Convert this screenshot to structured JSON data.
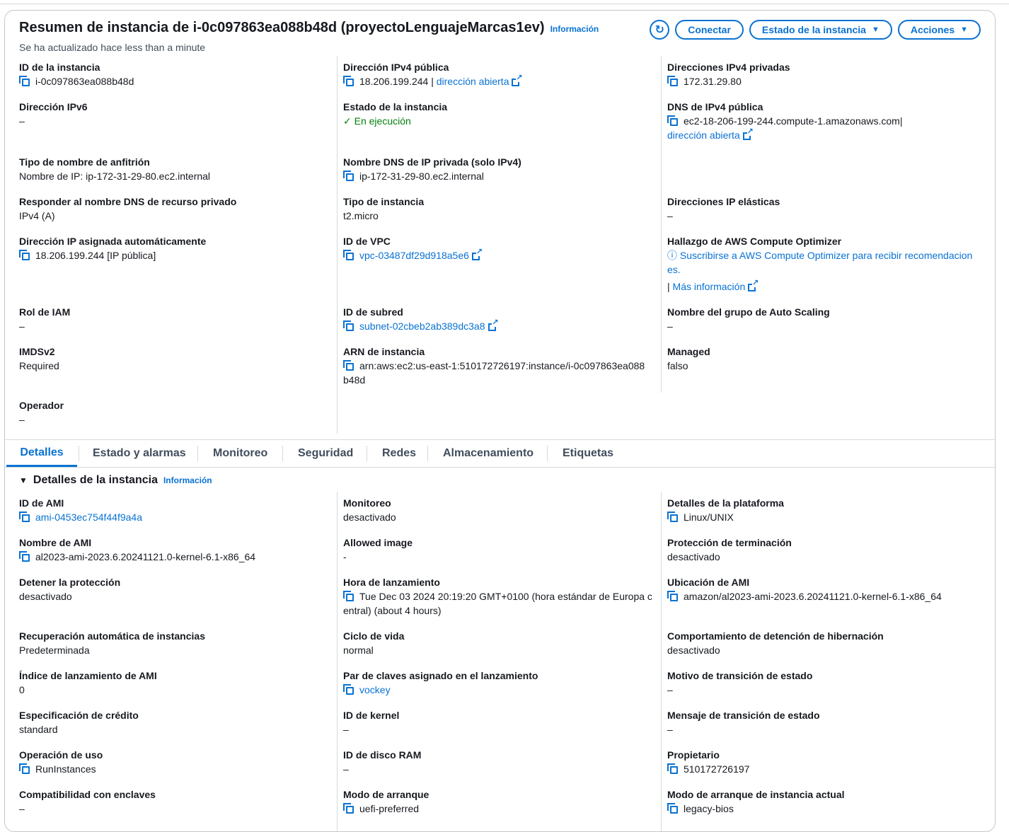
{
  "header": {
    "title": "Resumen de instancia de i-0c097863ea088b48d (proyectoLenguajeMarcas1ev)",
    "info": "Información",
    "subtitle": "Se ha actualizado hace less than a minute",
    "buttons": {
      "connect": "Conectar",
      "state": "Estado de la instancia",
      "actions": "Acciones"
    }
  },
  "summary": {
    "instance_id": {
      "label": "ID de la instancia",
      "value": "i-0c097863ea088b48d"
    },
    "ipv6": {
      "label": "Dirección IPv6",
      "value": "–"
    },
    "hostname_type": {
      "label": "Tipo de nombre de anfitrión",
      "value": "Nombre de IP: ip-172-31-29-80.ec2.internal"
    },
    "dns_respond": {
      "label": "Responder al nombre DNS de recurso privado",
      "value": "IPv4 (A)"
    },
    "auto_ip": {
      "label": "Dirección IP asignada automáticamente",
      "value": "18.206.199.244 [IP pública]"
    },
    "iam_role": {
      "label": "Rol de IAM",
      "value": "–"
    },
    "imdsv2": {
      "label": "IMDSv2",
      "value": "Required"
    },
    "operator": {
      "label": "Operador",
      "value": "–"
    },
    "public_ipv4": {
      "label": "Dirección IPv4 pública",
      "value": "18.206.199.244",
      "sep": "|",
      "link": "dirección abierta"
    },
    "state": {
      "label": "Estado de la instancia",
      "value": "En ejecución"
    },
    "private_dns": {
      "label": "Nombre DNS de IP privada (solo IPv4)",
      "value": "ip-172-31-29-80.ec2.internal"
    },
    "instance_type": {
      "label": "Tipo de instancia",
      "value": "t2.micro"
    },
    "vpc": {
      "label": "ID de VPC",
      "value": "vpc-03487df29d918a5e6"
    },
    "subnet": {
      "label": "ID de subred",
      "value": "subnet-02cbeb2ab389dc3a8"
    },
    "arn": {
      "label": "ARN de instancia",
      "value1": "arn:aws:ec2:us-east-1:510172726197:instance/i-0c097863ea088",
      "value2": "b48d"
    },
    "private_ipv4": {
      "label": "Direcciones IPv4 privadas",
      "value": "172.31.29.80"
    },
    "public_dns": {
      "label": "DNS de IPv4 pública",
      "value": "ec2-18-206-199-244.compute-1.amazonaws.com",
      "sep": "|",
      "link": "dirección abierta"
    },
    "elastic_ip": {
      "label": "Direcciones IP elásticas",
      "value": "–"
    },
    "optimizer": {
      "label": "Hallazgo de AWS Compute Optimizer",
      "link1": "Suscribirse a AWS Compute Optimizer para recibir recomendacion",
      "link2": "es.",
      "sep": "|",
      "more": "Más información"
    },
    "asg": {
      "label": "Nombre del grupo de Auto Scaling",
      "value": "–"
    },
    "managed": {
      "label": "Managed",
      "value": "falso"
    }
  },
  "tabs": [
    "Detalles",
    "Estado y alarmas",
    "Monitoreo",
    "Seguridad",
    "Redes",
    "Almacenamiento",
    "Etiquetas"
  ],
  "details": {
    "title": "Detalles de la instancia",
    "info": "Información",
    "ami_id": {
      "label": "ID de AMI",
      "value": "ami-0453ec754f44f9a4a"
    },
    "ami_name": {
      "label": "Nombre de AMI",
      "value": "al2023-ami-2023.6.20241121.0-kernel-6.1-x86_64"
    },
    "stop_protection": {
      "label": "Detener la protección",
      "value": "desactivado"
    },
    "auto_recovery": {
      "label": "Recuperación automática de instancias",
      "value": "Predeterminada"
    },
    "ami_launch_index": {
      "label": "Índice de lanzamiento de AMI",
      "value": "0"
    },
    "credit_spec": {
      "label": "Especificación de crédito",
      "value": "standard"
    },
    "usage_op": {
      "label": "Operación de uso",
      "value": "RunInstances"
    },
    "enclaves": {
      "label": "Compatibilidad con enclaves",
      "value": "–"
    },
    "monitoring": {
      "label": "Monitoreo",
      "value": "desactivado"
    },
    "allowed_image": {
      "label": "Allowed image",
      "value": "-"
    },
    "launch_time": {
      "label": "Hora de lanzamiento",
      "value1": "Tue Dec 03 2024 20:19:20 GMT+0100 (hora estándar de Europa c",
      "value2": "entral) (about 4 hours)"
    },
    "lifecycle": {
      "label": "Ciclo de vida",
      "value": "normal"
    },
    "key_pair": {
      "label": "Par de claves asignado en el lanzamiento",
      "value": "vockey"
    },
    "kernel_id": {
      "label": "ID de kernel",
      "value": "–"
    },
    "ramdisk_id": {
      "label": "ID de disco RAM",
      "value": "–"
    },
    "boot_mode": {
      "label": "Modo de arranque",
      "value": "uefi-preferred"
    },
    "platform": {
      "label": "Detalles de la plataforma",
      "value": "Linux/UNIX"
    },
    "term_protection": {
      "label": "Protección de terminación",
      "value": "desactivado"
    },
    "ami_location": {
      "label": "Ubicación de AMI",
      "value": "amazon/al2023-ami-2023.6.20241121.0-kernel-6.1-x86_64"
    },
    "hibernation": {
      "label": "Comportamiento de detención de hibernación",
      "value": "desactivado"
    },
    "transition_reason": {
      "label": "Motivo de transición de estado",
      "value": "–"
    },
    "transition_msg": {
      "label": "Mensaje de transición de estado",
      "value": "–"
    },
    "owner": {
      "label": "Propietario",
      "value": "510172726197"
    },
    "current_boot": {
      "label": "Modo de arranque de instancia actual",
      "value": "legacy-bios"
    }
  }
}
